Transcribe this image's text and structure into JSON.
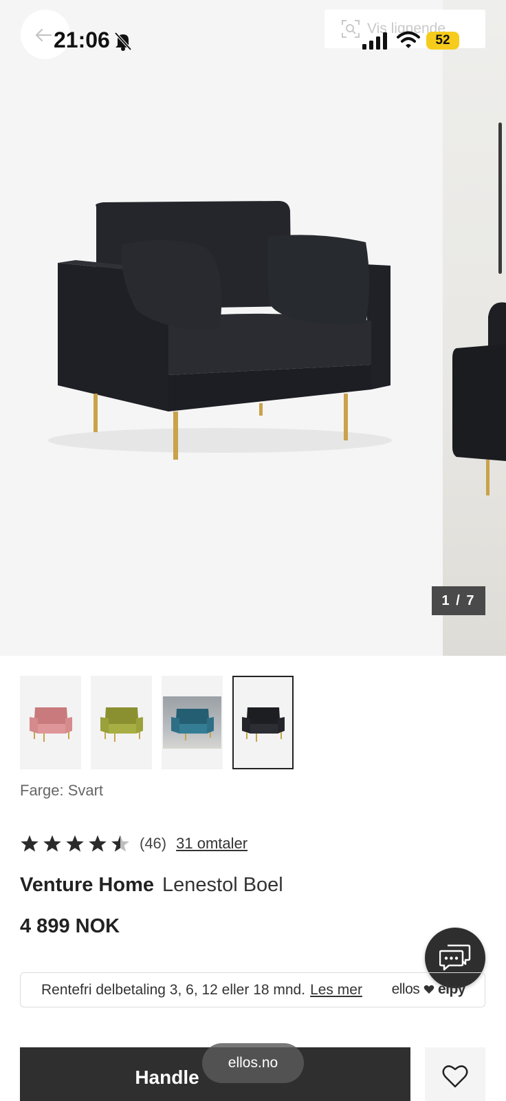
{
  "status_bar": {
    "time": "21:06",
    "battery": "52"
  },
  "nav": {
    "similar_label": "Vis lignende"
  },
  "gallery": {
    "counter": "1 / 7"
  },
  "thumbnails": [
    {
      "color_name": "Rosa",
      "hex": "#d58a8c"
    },
    {
      "color_name": "Grønn",
      "hex": "#9aa13a"
    },
    {
      "color_name": "Blå",
      "hex": "#2e6f86"
    },
    {
      "color_name": "Svart",
      "hex": "#23252a"
    }
  ],
  "product": {
    "color_label": "Farge: Svart",
    "rating": 4.5,
    "rating_count": "(46)",
    "reviews_link": "31 omtaler",
    "brand": "Venture Home",
    "name": "Lenestol Boel",
    "price": "4 899 NOK"
  },
  "finance": {
    "text": "Rentefri delbetaling 3, 6, 12 eller 18 mnd.",
    "link": "Les mer",
    "logo_prefix": "ellos",
    "logo_suffix": "elpy"
  },
  "actions": {
    "buy_label": "Handle",
    "url": "ellos.no"
  },
  "colors": {
    "accent_dark": "#2f2f2f",
    "battery": "#f6cc1c",
    "background": "#ffffff"
  }
}
